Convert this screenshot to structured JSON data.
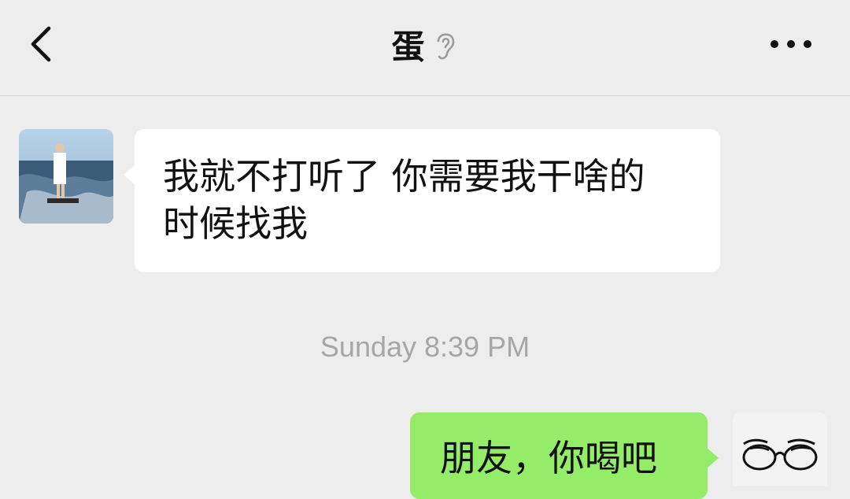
{
  "header": {
    "title": "蛋",
    "icons": {
      "back": "chevron-left-icon",
      "ear": "ear-icon",
      "more": "more-dots-icon"
    }
  },
  "messages": [
    {
      "direction": "incoming",
      "text_line1": "我就不打听了 你需要我干啥的",
      "text_line2": "时候找我"
    },
    {
      "direction": "outgoing",
      "text": "朋友，你喝吧"
    }
  ],
  "timestamp": "Sunday 8:39 PM",
  "colors": {
    "background": "#ededed",
    "incoming_bubble": "#ffffff",
    "outgoing_bubble": "#95ec69",
    "timestamp": "#a6a6a6"
  }
}
